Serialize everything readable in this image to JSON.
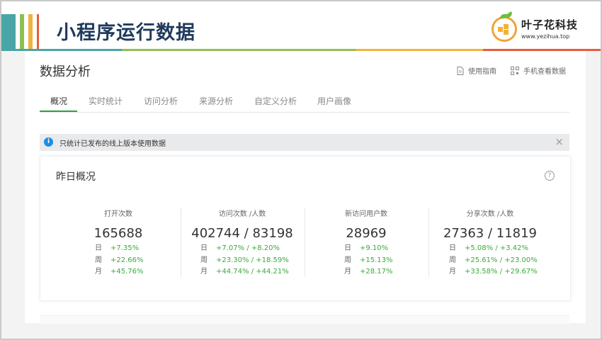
{
  "slide": {
    "title": "小程序运行数据"
  },
  "logo": {
    "name": "叶子花科技",
    "url": "www.yezihua.top"
  },
  "page": {
    "title": "数据分析"
  },
  "top_links": [
    {
      "label": "使用指南",
      "icon": "document-icon"
    },
    {
      "label": "手机查看数据",
      "icon": "qrcode-icon"
    }
  ],
  "tabs": [
    {
      "label": "概况"
    },
    {
      "label": "实时统计"
    },
    {
      "label": "访问分析"
    },
    {
      "label": "来源分析"
    },
    {
      "label": "自定义分析"
    },
    {
      "label": "用户画像"
    }
  ],
  "notice": {
    "text": "只统计已发布的线上版本使用数据"
  },
  "overview": {
    "title": "昨日概况",
    "help": "?",
    "stats": [
      {
        "label": "打开次数",
        "value": "165688",
        "rows": [
          {
            "k": "日",
            "v": "+7.35%"
          },
          {
            "k": "周",
            "v": "+22.66%"
          },
          {
            "k": "月",
            "v": "+45.76%"
          }
        ]
      },
      {
        "label": "访问次数 /人数",
        "value": "402744 / 83198",
        "rows": [
          {
            "k": "日",
            "v": "+7.07% / +8.20%"
          },
          {
            "k": "周",
            "v": "+23.30% / +18.59%"
          },
          {
            "k": "月",
            "v": "+44.74% / +44.21%"
          }
        ]
      },
      {
        "label": "新访问用户数",
        "value": "28969",
        "rows": [
          {
            "k": "日",
            "v": "+9.10%"
          },
          {
            "k": "周",
            "v": "+15.13%"
          },
          {
            "k": "月",
            "v": "+28.17%"
          }
        ]
      },
      {
        "label": "分享次数 /人数",
        "value": "27363 / 11819",
        "rows": [
          {
            "k": "日",
            "v": "+5.08% / +3.42%"
          },
          {
            "k": "周",
            "v": "+25.61% / +23.00%"
          },
          {
            "k": "月",
            "v": "+33.58% / +29.67%"
          }
        ]
      }
    ]
  },
  "colors": {
    "accent_green": "#2ea043",
    "positive": "#3aab3a",
    "info_blue": "#1a8ee6",
    "title_navy": "#1f3a5c"
  }
}
